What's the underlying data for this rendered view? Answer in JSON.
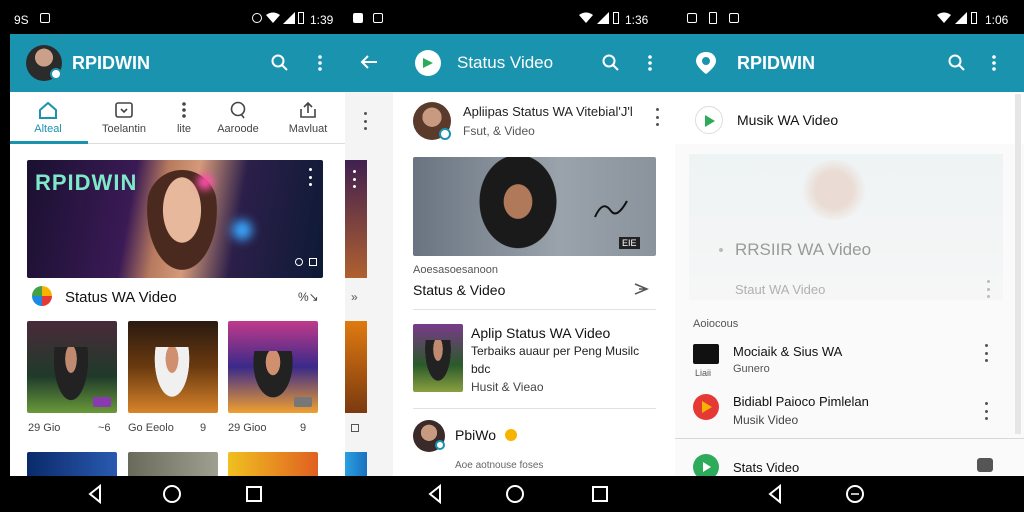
{
  "status_bars": [
    {
      "left_icons": [
        "whatsapp-icon",
        "gallery-icon"
      ],
      "time": "1:39"
    },
    {
      "left_icons": [
        "notification-icon",
        "sim-icon"
      ],
      "time": "1:36"
    },
    {
      "left_icons": [
        "photo-icon",
        "battery-small-icon",
        "b-icon"
      ],
      "time": "1:06"
    }
  ],
  "status_left_text": "9S",
  "panel1": {
    "app_title": "RPIDWIN",
    "tabs": [
      {
        "label": "Alteal",
        "icon": "home-icon",
        "active": true
      },
      {
        "label": "Toelantin",
        "icon": "download-icon",
        "active": false
      },
      {
        "label": "lite",
        "icon": "more-vertical-icon",
        "active": false
      },
      {
        "label": "Aaroode",
        "icon": "chat-icon",
        "active": false
      },
      {
        "label": "Mavluat",
        "icon": "upload-icon",
        "active": false
      }
    ],
    "hero_brand": "RPIDWIN",
    "section_title": "Status WA Video",
    "section_action": "%↘",
    "cards": [
      {
        "meta": "29 Gio",
        "corner": "~6"
      },
      {
        "meta": "Go Eeolo",
        "corner": "9"
      },
      {
        "meta": "29 Gioo",
        "corner": "9"
      }
    ]
  },
  "panel2": {
    "app_title": "Status Video",
    "post1": {
      "title": "Apliipas Status WA Vitebial'J'l",
      "subtitle": "Fsut, & Video"
    },
    "hero_badge": "EIE",
    "caption_small": "Aoesasoesanoon",
    "caption_title": "Status & Video",
    "item": {
      "title": "Aplip Status WA Video",
      "line2": "Terbaiks auaur per Peng Musilc",
      "line3": "bdc",
      "line4": "Husit & Vieao"
    },
    "user": {
      "name": "PbiWo",
      "sub": "Aoe aotnouse foses"
    }
  },
  "panel3": {
    "app_title": "RPIDWIN",
    "featured": {
      "title": "Musik WA Video"
    },
    "overlay_title": "RRSIIR WA Video",
    "overlay_sub": "Staut WA Video",
    "section_label": "Aoiocous",
    "rows": [
      {
        "title": "Mociaik & Sius WA",
        "sub": "Gunero",
        "icon_label": "Liaii"
      },
      {
        "title": "Bidiabl Paioco Pimlelan",
        "sub": "Musik Video"
      },
      {
        "title": "Stats Video"
      }
    ]
  },
  "colors": {
    "accent": "#1a93ae",
    "appbar": "#1a93ae",
    "bg": "#ffffff",
    "red_icon": "#e53935",
    "green_icon": "#2eab5a"
  }
}
